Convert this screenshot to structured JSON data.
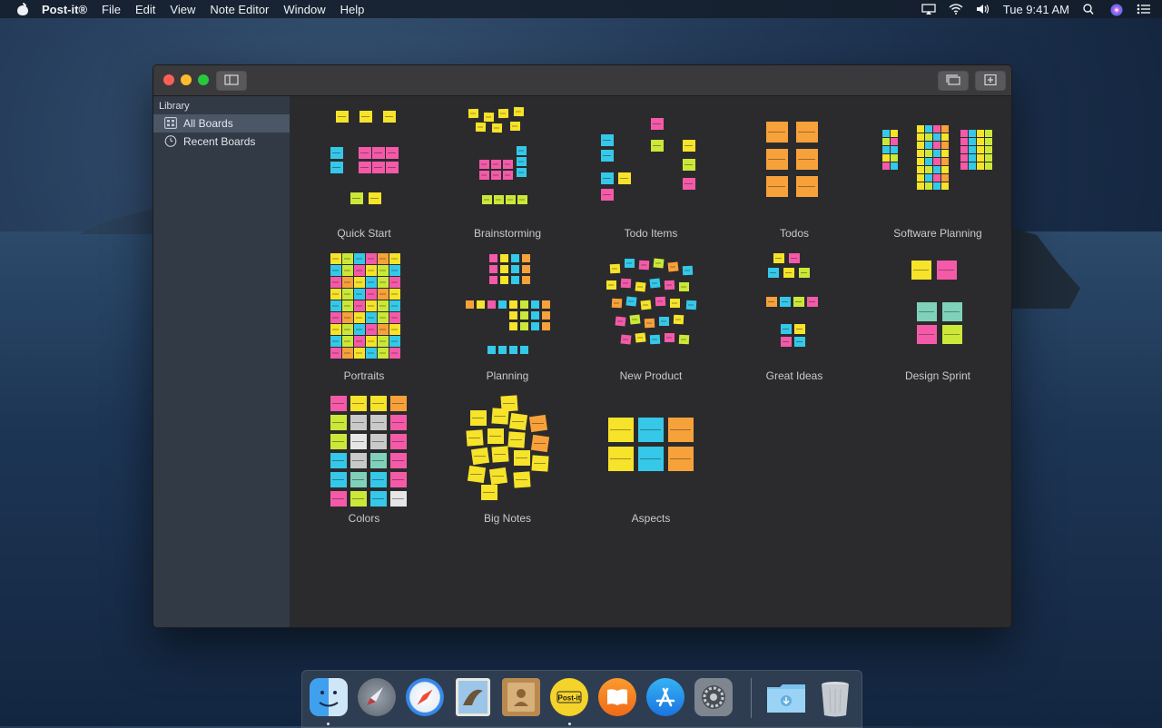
{
  "menubar": {
    "app_name": "Post-it®",
    "items": [
      "File",
      "Edit",
      "View",
      "Note Editor",
      "Window",
      "Help"
    ],
    "clock": "Tue 9:41 AM",
    "tray_icons": [
      "airplay-icon",
      "wifi-icon",
      "volume-icon",
      "spotlight-icon",
      "siri-icon",
      "notification-center-icon"
    ]
  },
  "window": {
    "sidebar": {
      "heading": "Library",
      "items": [
        {
          "label": "All Boards",
          "icon": "grid-icon",
          "active": true
        },
        {
          "label": "Recent Boards",
          "icon": "clock-icon",
          "active": false
        }
      ]
    },
    "boards": [
      {
        "label": "Quick Start"
      },
      {
        "label": "Brainstorming"
      },
      {
        "label": "Todo Items"
      },
      {
        "label": "Todos"
      },
      {
        "label": "Software Planning"
      },
      {
        "label": "Portraits"
      },
      {
        "label": "Planning"
      },
      {
        "label": "New Product"
      },
      {
        "label": "Great Ideas"
      },
      {
        "label": "Design Sprint"
      },
      {
        "label": "Colors"
      },
      {
        "label": "Big Notes"
      },
      {
        "label": "Aspects"
      }
    ]
  },
  "dock": {
    "apps": [
      "finder-icon",
      "launchpad-icon",
      "safari-icon",
      "mail-icon",
      "contacts-icon",
      "post-it-icon",
      "books-icon",
      "app-store-icon",
      "system-preferences-icon",
      "downloads-folder-icon",
      "trash-icon"
    ],
    "post_it_label": "Post-it"
  },
  "colors": {
    "yellow": "#f6e32a",
    "cyan": "#35c8e8",
    "pink": "#f45aa8",
    "lime": "#cbe838",
    "orange": "#f7a13a",
    "sidebar_active": "#4b5667"
  }
}
